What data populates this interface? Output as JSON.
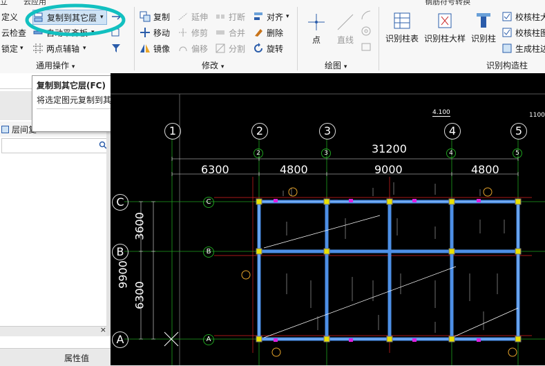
{
  "ribbon": {
    "top_tab_fragment": "云应用",
    "top_right_fragment": "钢筋符号转换",
    "general_ops": {
      "define": "定义",
      "cloud_check": "云检查",
      "lock": "锁定",
      "copy_to_other_floor": "复制到其它层",
      "auto_align_slab": "自动平齐板",
      "two_point_axis": "两点辅轴",
      "group_label": "通用操作"
    },
    "modify": {
      "copy": "复制",
      "move": "移动",
      "mirror": "镜像",
      "extend": "延伸",
      "trim": "修剪",
      "offset": "偏移",
      "break": "打断",
      "merge": "合并",
      "split": "分割",
      "align": "对齐",
      "delete": "删除",
      "rotate": "旋转",
      "group_label": "修改"
    },
    "draw": {
      "point": "点",
      "line": "直线",
      "group_label": "绘图"
    },
    "identify": {
      "col_table": "识别柱表",
      "col_detail": "识别柱大样",
      "col": "识别柱",
      "check_col_detail": "校核柱大",
      "check_col_figure": "校核柱图",
      "gen_edge": "生成柱边",
      "group_label": "识别构造柱"
    }
  },
  "tooltip": {
    "title": "复制到其它层(FC)",
    "desc": "将选定图元复制到其它层"
  },
  "left_panel": {
    "floor_item": "层间复",
    "footer_label": "属性值"
  },
  "drawing": {
    "axes_top": [
      "1",
      "2",
      "3",
      "4",
      "5"
    ],
    "axes_left": [
      "C",
      "B",
      "A"
    ],
    "dim_total": "31200",
    "dim_spans": [
      "6300",
      "4800",
      "9000",
      "4800"
    ],
    "dim_left_total": "9900",
    "dim_left_spans": [
      "3600",
      "6300"
    ],
    "elev_note": "4.100",
    "elev_right": "1100"
  }
}
